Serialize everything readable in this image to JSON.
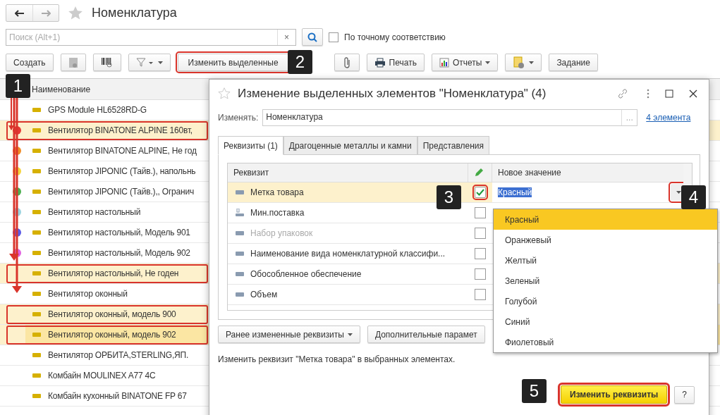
{
  "header": {
    "title": "Номенклатура"
  },
  "search": {
    "placeholder": "Поиск (Alt+1)",
    "clear": "×",
    "exact_match": {
      "label": "По точному соответствию",
      "checked": false
    }
  },
  "toolbar": [
    {
      "kind": "text",
      "label": "Создать",
      "marked": false
    },
    {
      "kind": "copy",
      "marked": false
    },
    {
      "kind": "barcode",
      "marked": false
    },
    {
      "kind": "filter",
      "marked": false
    },
    {
      "kind": "text",
      "label": "Изменить выделенные",
      "marked": true
    },
    {
      "kind": "paperclip",
      "marked": false
    },
    {
      "kind": "print",
      "label": "Печать",
      "marked": false
    },
    {
      "kind": "reports",
      "label": "Отчеты",
      "marked": false
    },
    {
      "kind": "documents",
      "marked": false
    },
    {
      "kind": "text",
      "label": "Задание",
      "marked": false
    }
  ],
  "list": {
    "column": "Наименование",
    "rows": [
      {
        "name": "GPS Module HL6528RD-G",
        "selected": false,
        "current": false,
        "marked": false
      },
      {
        "name": "Вентилятор BINATONE ALPINE 160вт,",
        "selected": true,
        "current": false,
        "marked": true,
        "color": "#e53935"
      },
      {
        "name": "Вентилятор BINATONE ALPINE, Не год",
        "selected": false,
        "current": false,
        "marked": false,
        "color": "#f08c28"
      },
      {
        "name": "Вентилятор JIPONIC (Тайв.), напольнь",
        "selected": false,
        "current": false,
        "marked": false,
        "color": "#f5d33c"
      },
      {
        "name": "Вентилятор JIPONIC (Тайв.),, Огранич",
        "selected": false,
        "current": false,
        "marked": false,
        "color": "#4caf50"
      },
      {
        "name": "Вентилятор настольный",
        "selected": false,
        "current": false,
        "marked": false,
        "color": "#9ad3e0"
      },
      {
        "name": "Вентилятор настольный, Модель 901",
        "selected": false,
        "current": false,
        "marked": false,
        "color": "#5a5ae6"
      },
      {
        "name": "Вентилятор настольный, Модель 902",
        "selected": false,
        "current": false,
        "marked": false,
        "color": "#e060e0"
      },
      {
        "name": "Вентилятор настольный, Не годен",
        "selected": true,
        "current": false,
        "marked": true
      },
      {
        "name": "Вентилятор оконный",
        "selected": false,
        "current": false,
        "marked": false
      },
      {
        "name": "Вентилятор оконный, модель 900",
        "selected": true,
        "current": false,
        "marked": true
      },
      {
        "name": "Вентилятор оконный, модель 902",
        "selected": true,
        "current": true,
        "marked": true
      },
      {
        "name": "Вентилятор ОРБИТА,STERLING,ЯП.",
        "selected": false,
        "current": false,
        "marked": false
      },
      {
        "name": "Комбайн MOULINEX  A77 4C",
        "selected": false,
        "current": false,
        "marked": false
      },
      {
        "name": "Комбайн кухонный BINATONE FP 67",
        "selected": false,
        "current": false,
        "marked": false
      }
    ]
  },
  "dialog": {
    "title": "Изменение выделенных элементов \"Номенклатура\" (4)",
    "object_label": "Изменять:",
    "object_value": "Номенклатура",
    "object_choice": "...",
    "count_link": "4 элемента",
    "tabs": [
      {
        "label": "Реквизиты (1)",
        "selected": true
      },
      {
        "label": "Драгоценные металлы и камни",
        "selected": false
      },
      {
        "label": "Представления",
        "selected": false
      }
    ],
    "table": {
      "columns": [
        "Реквизит",
        "Новое значение"
      ],
      "rows": [
        {
          "name": "Метка товара",
          "kind": "field",
          "checked": true,
          "disabled": false,
          "selected": true,
          "value": "Красный",
          "marked": true
        },
        {
          "name": "Мин.поставка",
          "kind": "numeric",
          "checked": false,
          "disabled": false,
          "selected": false,
          "marked": false
        },
        {
          "name": "Набор упаковок",
          "kind": "field",
          "checked": false,
          "disabled": true,
          "selected": false,
          "marked": false
        },
        {
          "name": "Наименование вида номенклатурной классифи...",
          "kind": "field",
          "checked": false,
          "disabled": false,
          "selected": false,
          "marked": false
        },
        {
          "name": "Обособленное обеспечение",
          "kind": "field",
          "checked": false,
          "disabled": false,
          "selected": false,
          "marked": false
        },
        {
          "name": "Объем",
          "kind": "field",
          "checked": false,
          "disabled": false,
          "selected": false,
          "marked": false
        }
      ]
    },
    "dropdown": [
      {
        "label": "Красный",
        "selected": true
      },
      {
        "label": "Оранжевый",
        "selected": false
      },
      {
        "label": "Желтый",
        "selected": false
      },
      {
        "label": "Зеленый",
        "selected": false
      },
      {
        "label": "Голубой",
        "selected": false
      },
      {
        "label": "Синий",
        "selected": false
      },
      {
        "label": "Фиолетовый",
        "selected": false
      }
    ],
    "buttons": [
      "Ранее измененные реквизиты",
      "Дополнительные парамет"
    ],
    "info": "Изменить реквизит \"Метка товара\" в выбранных элементах.",
    "primary": {
      "label": "Изменить реквизиты",
      "marked": true
    },
    "help": "?"
  },
  "callouts": [
    "1",
    "2",
    "3",
    "4",
    "5"
  ]
}
